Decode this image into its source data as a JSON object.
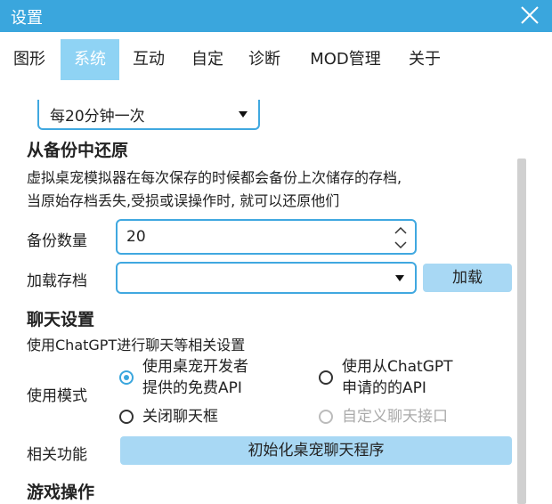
{
  "window": {
    "title": "设置"
  },
  "tabs": [
    "图形",
    "系统",
    "互动",
    "自定",
    "诊断",
    "MOD管理",
    "关于"
  ],
  "backup_interval": {
    "selected": "每20分钟一次"
  },
  "restore": {
    "heading": "从备份中还原",
    "desc_line1": "虚拟桌宠模拟器在每次保存的时候都会备份上次储存的存档,",
    "desc_line2": "当原始存档丢失,受损或误操作时, 就可以还原他们",
    "backup_count_label": "备份数量",
    "backup_count_value": "20",
    "load_save_label": "加载存档",
    "load_save_value": "",
    "load_button": "加载"
  },
  "chat": {
    "heading": "聊天设置",
    "desc": "使用ChatGPT进行聊天等相关设置",
    "mode_label": "使用模式",
    "option1_line1": "使用桌宠开发者",
    "option1_line2": "提供的免费API",
    "option2_line1": "使用从ChatGPT",
    "option2_line2": "申请的的API",
    "option3": "关闭聊天框",
    "option4": "自定义聊天接口",
    "related_label": "相关功能",
    "init_button": "初始化桌宠聊天程序"
  },
  "game": {
    "heading": "游戏操作"
  }
}
